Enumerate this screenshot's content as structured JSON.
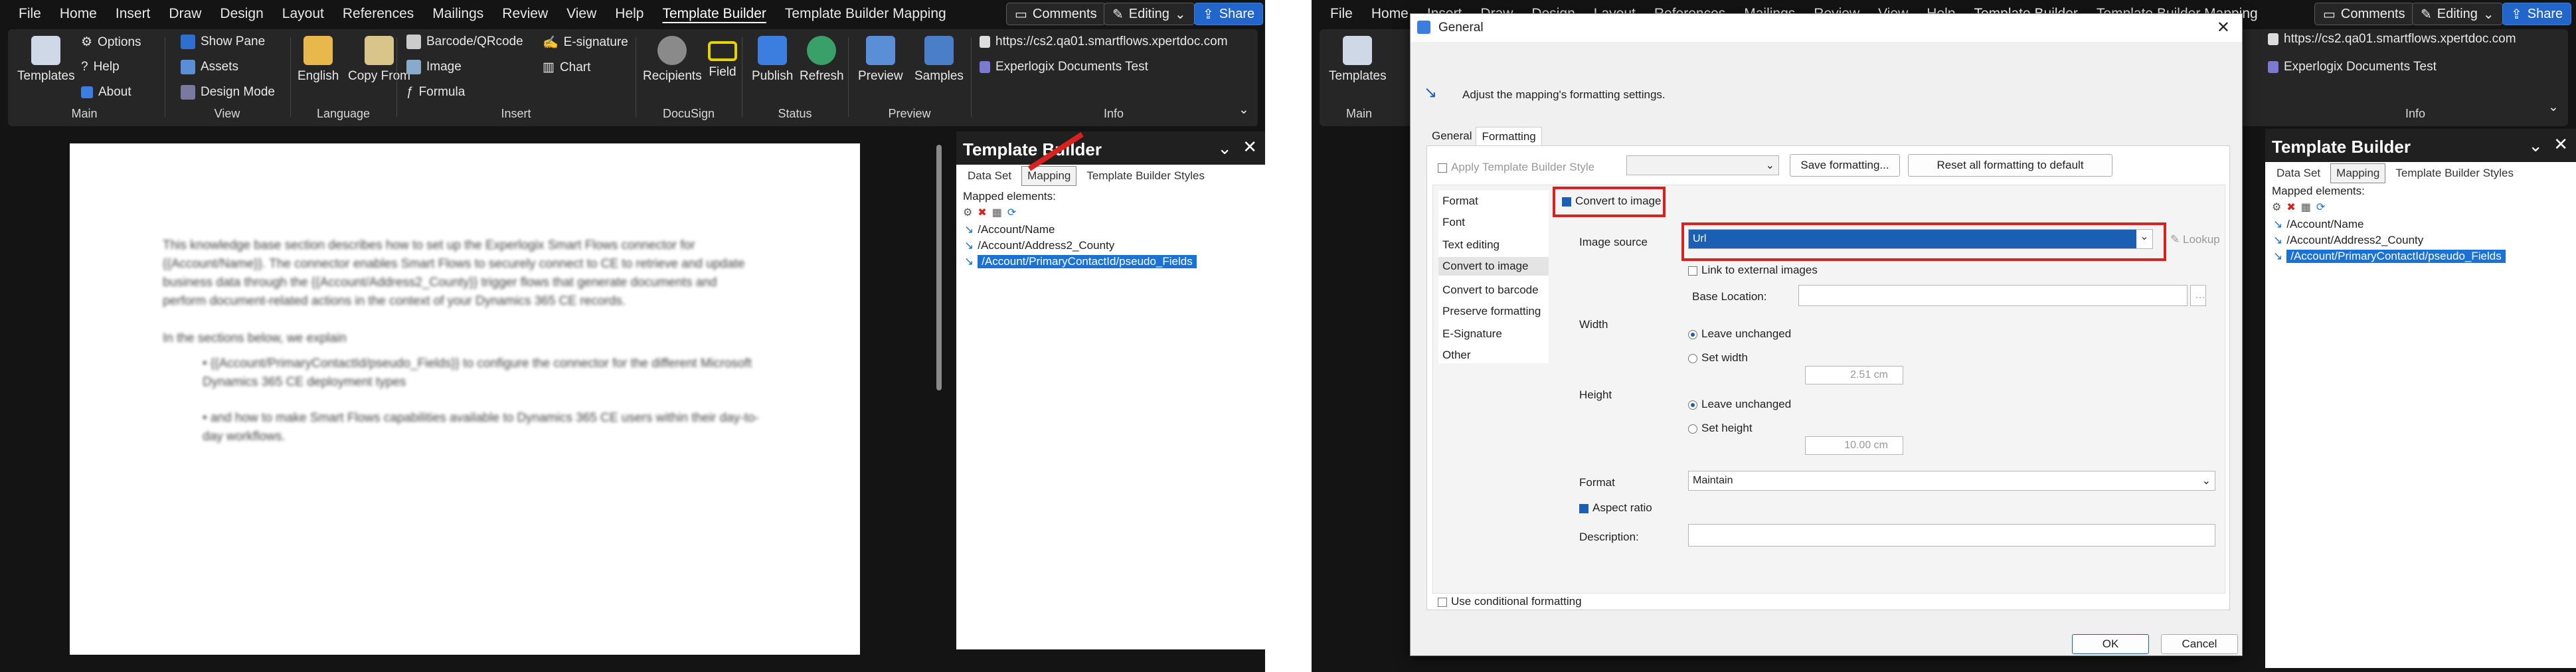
{
  "menu": [
    "File",
    "Home",
    "Insert",
    "Draw",
    "Design",
    "Layout",
    "References",
    "Mailings",
    "Review",
    "View",
    "Help",
    "Template Builder",
    "Template Builder Mapping"
  ],
  "menu_active": "Template Builder",
  "title_buttons": {
    "comments": "Comments",
    "editing": "Editing",
    "share": "Share"
  },
  "ribbon": {
    "main": {
      "label": "Main",
      "templates": "Templates",
      "options": "Options",
      "help": "Help",
      "about": "About"
    },
    "view": {
      "label": "View",
      "show_pane": "Show Pane",
      "assets": "Assets",
      "design_mode": "Design Mode"
    },
    "language": {
      "label": "Language",
      "english": "English",
      "copy_from": "Copy From"
    },
    "insert": {
      "label": "Insert",
      "barcode": "Barcode/QRcode",
      "image": "Image",
      "formula": "Formula",
      "esignature": "E-signature",
      "chart": "Chart"
    },
    "docusign": {
      "label": "DocuSign",
      "recipients": "Recipients",
      "field": "Field"
    },
    "status": {
      "label": "Status",
      "publish": "Publish",
      "refresh": "Refresh"
    },
    "preview": {
      "label": "Preview",
      "preview": "Preview",
      "samples": "Samples"
    },
    "info": {
      "label": "Info",
      "url": "https://cs2.qa01.smartflows.xpertdoc.com",
      "workspace": "Experlogix Documents Test"
    }
  },
  "document": {
    "p1": "This knowledge base section describes how to set up the Experlogix Smart Flows connector for {{Account/Name}}. The connector enables Smart Flows to securely connect to CE to retrieve and update business data through the {{Account/Address2_County}} trigger flows that generate documents and perform document-related actions in the context of your Dynamics 365 CE records.",
    "p2": "In the sections below, we explain",
    "bullets": [
      "{{Account/PrimaryContactId/pseudo_Fields}} to configure the connector for the different Microsoft Dynamics 365 CE deployment types",
      "and how to make Smart Flows capabilities available to Dynamics 365 CE users within their day-to-day workflows."
    ]
  },
  "taskpane": {
    "title": "Template Builder",
    "tabs": [
      "Data Set",
      "Mapping",
      "Template Builder Styles"
    ],
    "active_tab": "Mapping",
    "mapped_label": "Mapped elements:",
    "items": [
      "/Account/Name",
      "/Account/Address2_County",
      "/Account/PrimaryContactId/pseudo_Fields"
    ],
    "selected_index": 2
  },
  "dialog": {
    "title": "General",
    "description": "Adjust the mapping's formatting settings.",
    "tabs": [
      "General",
      "Formatting"
    ],
    "active_tab": "Formatting",
    "apply_style": "Apply Template Builder Style",
    "save_formatting": "Save formatting...",
    "reset_formatting": "Reset all formatting to default",
    "nav": [
      "Format",
      "Font",
      "Text editing",
      "Convert to image",
      "Convert to barcode",
      "Preserve formatting",
      "E-Signature",
      "Other"
    ],
    "nav_selected": "Convert to image",
    "convert_to_image": "Convert to image",
    "image_source_label": "Image source",
    "image_source_value": "Url",
    "lookup": "Lookup",
    "link_external": "Link to external images",
    "base_location": "Base Location:",
    "width_label": "Width",
    "height_label": "Height",
    "leave_unchanged": "Leave unchanged",
    "set_width": "Set width",
    "set_height": "Set height",
    "width_value": "2.51 cm",
    "height_value": "10.00 cm",
    "format_label": "Format",
    "format_value": "Maintain",
    "aspect_ratio": "Aspect ratio",
    "description_label": "Description:",
    "conditional": "Use conditional formatting",
    "ok": "OK",
    "cancel": "Cancel"
  },
  "colors": {
    "accent": "#1a73d4",
    "highlight_red": "#d9211e",
    "share_blue": "#2266cc"
  }
}
